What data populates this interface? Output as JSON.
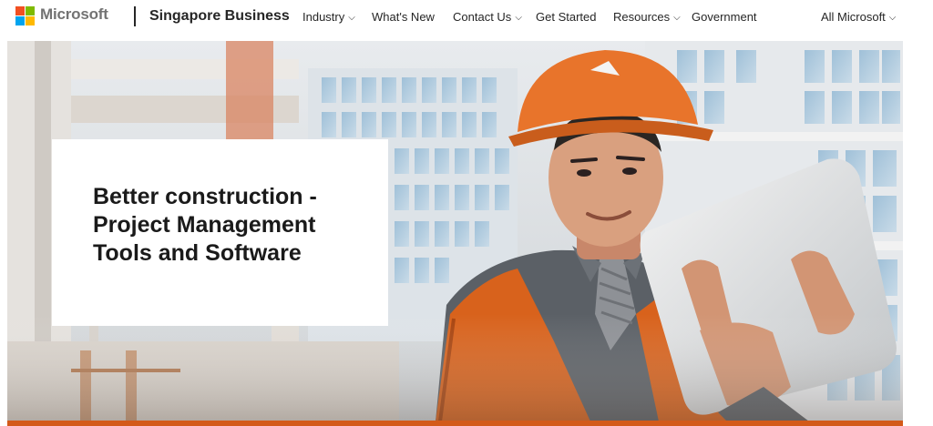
{
  "header": {
    "brand": "Microsoft",
    "site_title": "Singapore Business",
    "nav": [
      {
        "label": "Industry",
        "has_dropdown": true
      },
      {
        "label": "What's New",
        "has_dropdown": false
      },
      {
        "label": "Contact Us",
        "has_dropdown": true
      },
      {
        "label": "Get Started",
        "has_dropdown": false
      },
      {
        "label": "Resources",
        "has_dropdown": true
      },
      {
        "label": "Government",
        "has_dropdown": false
      }
    ],
    "all_microsoft": "All Microsoft",
    "chevron": "⌵"
  },
  "logo_colors": [
    "#f25022",
    "#7fba00",
    "#00a4ef",
    "#ffb900"
  ],
  "hero": {
    "title": "Better construction - Project Management Tools and Software",
    "accent_color": "#d35a1a"
  }
}
